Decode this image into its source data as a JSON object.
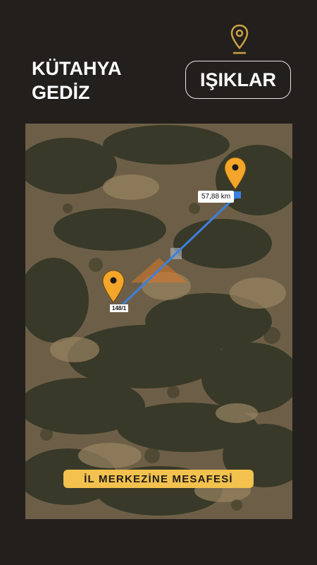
{
  "location": {
    "city": "KÜTAHYA",
    "district": "GEDİZ"
  },
  "district_button": {
    "label": "IŞIKLAR"
  },
  "map": {
    "distance_label": "57,88 km",
    "parcel_label": "148/1",
    "banner": "İL MERKEZİNE MESAFESİ"
  },
  "colors": {
    "accent": "#f2c14e",
    "pin": "#f4a62a",
    "route": "#3d7fe0",
    "background": "#231f1d"
  },
  "icons": {
    "top": "location-pin-icon",
    "map_pins": "map-marker-icon"
  }
}
